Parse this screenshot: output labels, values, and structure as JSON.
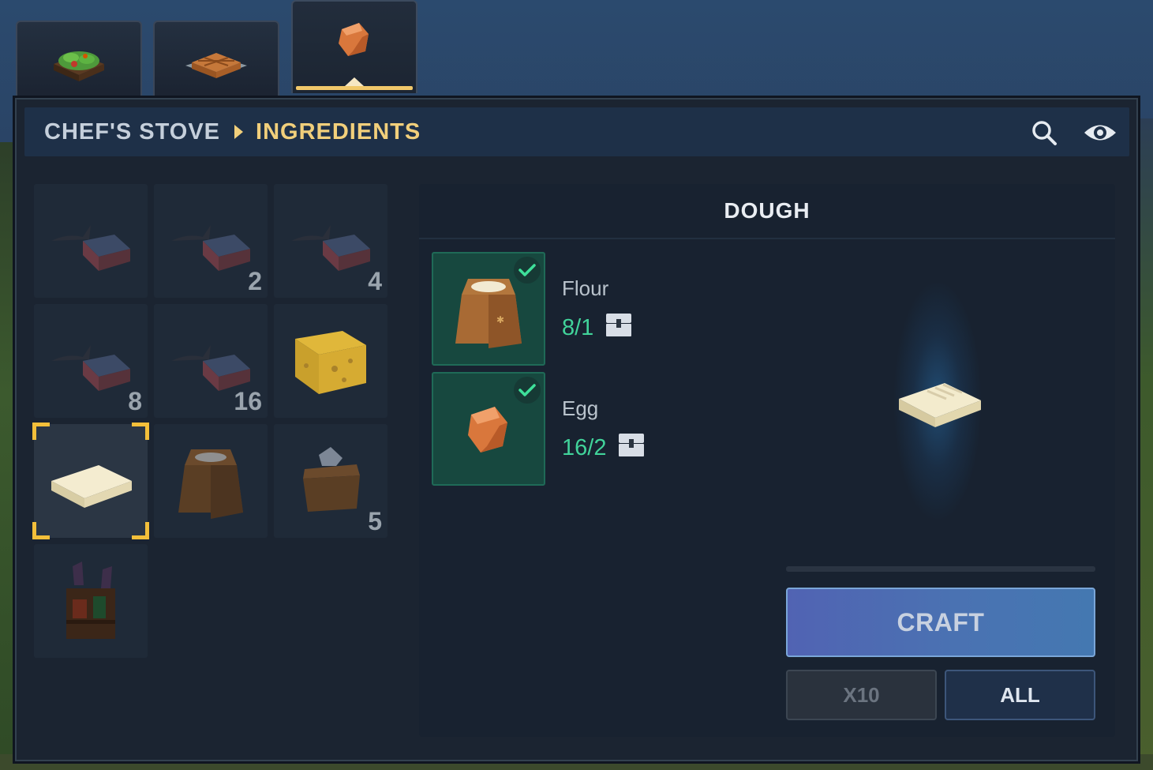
{
  "tabs": [
    {
      "name": "salad",
      "active": false
    },
    {
      "name": "pie",
      "active": false
    },
    {
      "name": "ingredients",
      "active": true
    }
  ],
  "breadcrumb": {
    "station": "CHEF'S STOVE",
    "category": "INGREDIENTS"
  },
  "header_icons": [
    "search-icon",
    "eye-icon"
  ],
  "recipes": [
    {
      "item": "meat-on-bone",
      "count": ""
    },
    {
      "item": "meat-on-bone",
      "count": "2"
    },
    {
      "item": "meat-on-bone",
      "count": "4"
    },
    {
      "item": "meat-on-bone",
      "count": "8"
    },
    {
      "item": "meat-on-bone",
      "count": "16"
    },
    {
      "item": "cheese",
      "count": ""
    },
    {
      "item": "dough",
      "count": "",
      "selected": true
    },
    {
      "item": "flour-sack",
      "count": ""
    },
    {
      "item": "salt-sack",
      "count": "5"
    },
    {
      "item": "spice-rack",
      "count": ""
    }
  ],
  "detail": {
    "title": "DOUGH",
    "ingredients": [
      {
        "name": "Flour",
        "qty": "8/1",
        "icon": "flour-sack",
        "satisfied": true
      },
      {
        "name": "Egg",
        "qty": "16/2",
        "icon": "egg",
        "satisfied": true
      }
    ],
    "craft_label": "CRAFT",
    "x10_label": "X10",
    "all_label": "ALL"
  },
  "colors": {
    "accent_gold": "#f1cf7b",
    "selection_gold": "#f3bf3a",
    "qty_green": "#41d39a",
    "craft_blue": "#4a72b2"
  }
}
